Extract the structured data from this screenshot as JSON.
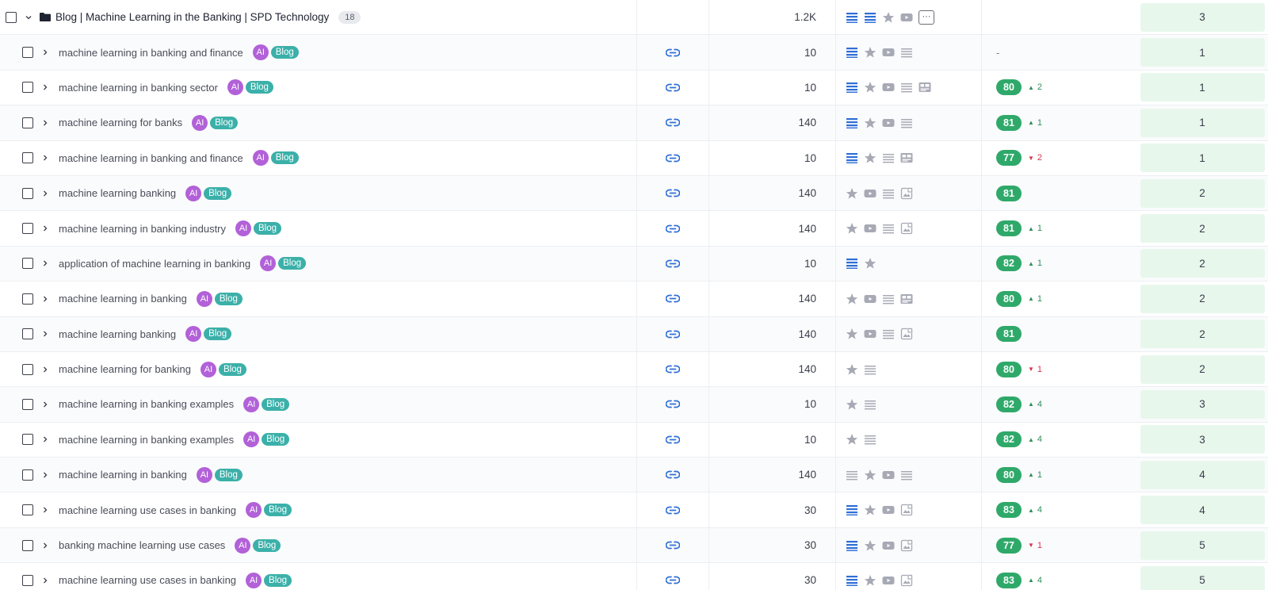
{
  "group": {
    "title": "Blog | Machine Learning in the Banking | SPD Technology",
    "count": "18",
    "volume": "1.2K",
    "features": [
      "list-blue",
      "list-blue",
      "star",
      "video",
      "more"
    ],
    "position": "3"
  },
  "rows": [
    {
      "keyword": "machine learning in banking and finance",
      "ai": "AI",
      "tag": "Blog",
      "volume": "10",
      "features": [
        "list-blue",
        "star",
        "video",
        "list-gray"
      ],
      "kd": "",
      "trend": "",
      "trend_dir": "",
      "position": "1",
      "dash": "-"
    },
    {
      "keyword": "machine learning in banking sector",
      "ai": "AI",
      "tag": "Blog",
      "volume": "10",
      "features": [
        "list-blue",
        "star",
        "video",
        "list-gray",
        "carousel"
      ],
      "kd": "80",
      "trend": "2",
      "trend_dir": "up",
      "position": "1"
    },
    {
      "keyword": "machine learning for banks",
      "ai": "AI",
      "tag": "Blog",
      "volume": "140",
      "features": [
        "list-blue",
        "star",
        "video",
        "list-gray"
      ],
      "kd": "81",
      "trend": "1",
      "trend_dir": "up",
      "position": "1"
    },
    {
      "keyword": "machine learning in banking and finance",
      "ai": "AI",
      "tag": "Blog",
      "volume": "10",
      "features": [
        "list-blue",
        "star",
        "list-gray",
        "carousel"
      ],
      "kd": "77",
      "trend": "2",
      "trend_dir": "down",
      "position": "1"
    },
    {
      "keyword": "machine learning banking",
      "ai": "AI",
      "tag": "Blog",
      "volume": "140",
      "features": [
        "star",
        "video",
        "list-gray",
        "image"
      ],
      "kd": "81",
      "trend": "",
      "trend_dir": "",
      "position": "2"
    },
    {
      "keyword": "machine learning in banking industry",
      "ai": "AI",
      "tag": "Blog",
      "volume": "140",
      "features": [
        "star",
        "video",
        "list-gray",
        "image"
      ],
      "kd": "81",
      "trend": "1",
      "trend_dir": "up",
      "position": "2"
    },
    {
      "keyword": "application of machine learning in banking",
      "ai": "AI",
      "tag": "Blog",
      "volume": "10",
      "features": [
        "list-blue",
        "star"
      ],
      "kd": "82",
      "trend": "1",
      "trend_dir": "up",
      "position": "2"
    },
    {
      "keyword": "machine learning in banking",
      "ai": "AI",
      "tag": "Blog",
      "volume": "140",
      "features": [
        "star",
        "video",
        "list-gray",
        "carousel"
      ],
      "kd": "80",
      "trend": "1",
      "trend_dir": "up",
      "position": "2"
    },
    {
      "keyword": "machine learning banking",
      "ai": "AI",
      "tag": "Blog",
      "volume": "140",
      "features": [
        "star",
        "video",
        "list-gray",
        "image"
      ],
      "kd": "81",
      "trend": "",
      "trend_dir": "",
      "position": "2"
    },
    {
      "keyword": "machine learning for banking",
      "ai": "AI",
      "tag": "Blog",
      "volume": "140",
      "features": [
        "star",
        "list-gray"
      ],
      "kd": "80",
      "trend": "1",
      "trend_dir": "down",
      "position": "2"
    },
    {
      "keyword": "machine learning in banking examples",
      "ai": "AI",
      "tag": "Blog",
      "volume": "10",
      "features": [
        "star",
        "list-gray"
      ],
      "kd": "82",
      "trend": "4",
      "trend_dir": "up",
      "position": "3"
    },
    {
      "keyword": "machine learning in banking examples",
      "ai": "AI",
      "tag": "Blog",
      "volume": "10",
      "features": [
        "star",
        "list-gray"
      ],
      "kd": "82",
      "trend": "4",
      "trend_dir": "up",
      "position": "3"
    },
    {
      "keyword": "machine learning in banking",
      "ai": "AI",
      "tag": "Blog",
      "volume": "140",
      "features": [
        "list-gray",
        "star",
        "video",
        "list-gray"
      ],
      "kd": "80",
      "trend": "1",
      "trend_dir": "up",
      "position": "4"
    },
    {
      "keyword": "machine learning use cases in banking",
      "ai": "AI",
      "tag": "Blog",
      "volume": "30",
      "features": [
        "list-blue",
        "star",
        "video",
        "image"
      ],
      "kd": "83",
      "trend": "4",
      "trend_dir": "up",
      "position": "4"
    },
    {
      "keyword": "banking machine learning use cases",
      "ai": "AI",
      "tag": "Blog",
      "volume": "30",
      "features": [
        "list-blue",
        "star",
        "video",
        "image"
      ],
      "kd": "77",
      "trend": "1",
      "trend_dir": "down",
      "position": "5"
    },
    {
      "keyword": "machine learning use cases in banking",
      "ai": "AI",
      "tag": "Blog",
      "volume": "30",
      "features": [
        "list-blue",
        "star",
        "video",
        "image"
      ],
      "kd": "83",
      "trend": "4",
      "trend_dir": "up",
      "position": "5"
    }
  ],
  "colors": {
    "accent_blue": "#2f6fd6",
    "icon_gray": "#a7a9b4",
    "kd_green": "#2fa96a",
    "trend_up": "#2f8f58",
    "trend_down": "#d8344a",
    "ai_purple": "#b261d8",
    "blog_teal": "#3bb0a9",
    "position_bg": "#e8f7ec"
  }
}
